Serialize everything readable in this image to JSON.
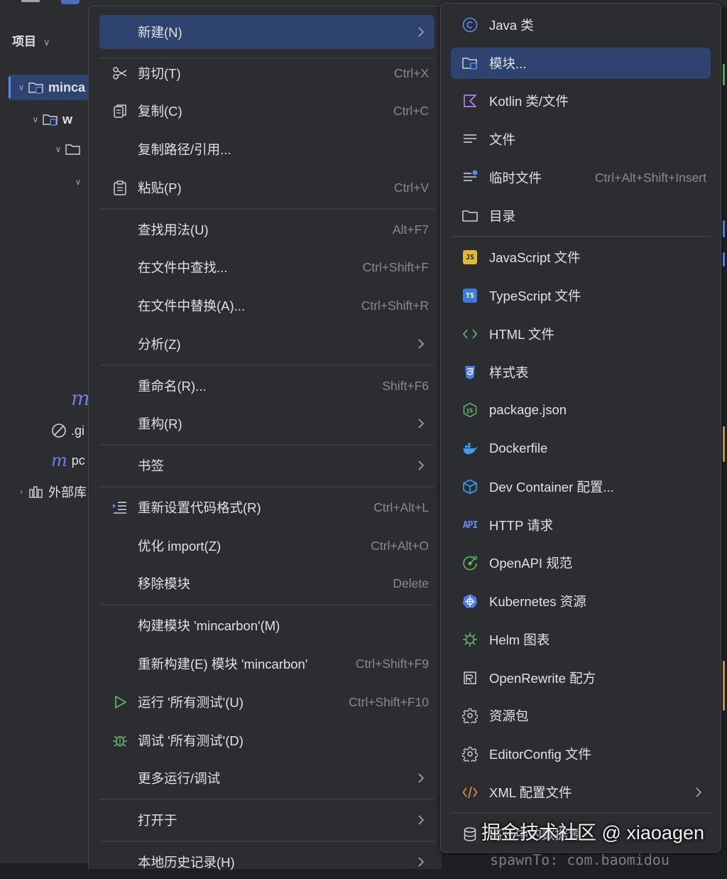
{
  "project_panel": {
    "title": "项目",
    "tree": {
      "root_label": "minca",
      "child_label": "w",
      "gitignore_label": ".gi",
      "pom_label": "pc",
      "external_label": "外部库",
      "maven_letter": "m"
    }
  },
  "context_menu": {
    "items": [
      {
        "label": "新建(N)",
        "shortcut": "",
        "icon": "none",
        "submenu": true
      },
      {
        "label": "剪切(T)",
        "shortcut": "Ctrl+X",
        "icon": "scissors-icon",
        "submenu": false
      },
      {
        "label": "复制(C)",
        "shortcut": "Ctrl+C",
        "icon": "copy-icon",
        "submenu": false
      },
      {
        "label": "复制路径/引用...",
        "shortcut": "",
        "icon": "none",
        "submenu": false
      },
      {
        "label": "粘贴(P)",
        "shortcut": "Ctrl+V",
        "icon": "paste-icon",
        "submenu": false
      },
      {
        "label": "查找用法(U)",
        "shortcut": "Alt+F7",
        "icon": "none",
        "submenu": false
      },
      {
        "label": "在文件中查找...",
        "shortcut": "Ctrl+Shift+F",
        "icon": "none",
        "submenu": false
      },
      {
        "label": "在文件中替换(A)...",
        "shortcut": "Ctrl+Shift+R",
        "icon": "none",
        "submenu": false
      },
      {
        "label": "分析(Z)",
        "shortcut": "",
        "icon": "none",
        "submenu": true
      },
      {
        "label": "重命名(R)...",
        "shortcut": "Shift+F6",
        "icon": "none",
        "submenu": false
      },
      {
        "label": "重构(R)",
        "shortcut": "",
        "icon": "none",
        "submenu": true
      },
      {
        "label": "书签",
        "shortcut": "",
        "icon": "none",
        "submenu": true
      },
      {
        "label": "重新设置代码格式(R)",
        "shortcut": "Ctrl+Alt+L",
        "icon": "reformat-icon",
        "submenu": false
      },
      {
        "label": "优化 import(Z)",
        "shortcut": "Ctrl+Alt+O",
        "icon": "none",
        "submenu": false
      },
      {
        "label": "移除模块",
        "shortcut": "Delete",
        "icon": "none",
        "submenu": false
      },
      {
        "label": "构建模块 'mincarbon'(M)",
        "shortcut": "",
        "icon": "none",
        "submenu": false
      },
      {
        "label": "重新构建(E) 模块 'mincarbon'",
        "shortcut": "Ctrl+Shift+F9",
        "icon": "none",
        "submenu": false
      },
      {
        "label": "运行 '所有测试'(U)",
        "shortcut": "Ctrl+Shift+F10",
        "icon": "run-icon",
        "submenu": false
      },
      {
        "label": "调试 '所有测试'(D)",
        "shortcut": "",
        "icon": "debug-bug-icon",
        "submenu": false
      },
      {
        "label": "更多运行/调试",
        "shortcut": "",
        "icon": "none",
        "submenu": true
      },
      {
        "label": "打开于",
        "shortcut": "",
        "icon": "none",
        "submenu": true
      },
      {
        "label": "本地历史记录(H)",
        "shortcut": "",
        "icon": "none",
        "submenu": true
      }
    ]
  },
  "new_submenu": {
    "items": [
      {
        "label": "Java 类",
        "shortcut": "",
        "icon": "java-class-icon"
      },
      {
        "label": "模块...",
        "shortcut": "",
        "icon": "module-icon"
      },
      {
        "label": "Kotlin 类/文件",
        "shortcut": "",
        "icon": "kotlin-icon"
      },
      {
        "label": "文件",
        "shortcut": "",
        "icon": "file-icon"
      },
      {
        "label": "临时文件",
        "shortcut": "Ctrl+Alt+Shift+Insert",
        "icon": "scratch-file-icon"
      },
      {
        "label": "目录",
        "shortcut": "",
        "icon": "folder-icon"
      },
      {
        "label": "JavaScript 文件",
        "shortcut": "",
        "icon": "javascript-icon"
      },
      {
        "label": "TypeScript 文件",
        "shortcut": "",
        "icon": "typescript-icon"
      },
      {
        "label": "HTML 文件",
        "shortcut": "",
        "icon": "html-icon"
      },
      {
        "label": "样式表",
        "shortcut": "",
        "icon": "css-icon"
      },
      {
        "label": "package.json",
        "shortcut": "",
        "icon": "nodejs-icon"
      },
      {
        "label": "Dockerfile",
        "shortcut": "",
        "icon": "docker-icon"
      },
      {
        "label": "Dev Container 配置...",
        "shortcut": "",
        "icon": "dev-container-icon"
      },
      {
        "label": "HTTP 请求",
        "shortcut": "",
        "icon": "api-icon"
      },
      {
        "label": "OpenAPI 规范",
        "shortcut": "",
        "icon": "openapi-icon"
      },
      {
        "label": "Kubernetes 资源",
        "shortcut": "",
        "icon": "kubernetes-icon"
      },
      {
        "label": "Helm 图表",
        "shortcut": "",
        "icon": "helm-icon"
      },
      {
        "label": "OpenRewrite 配方",
        "shortcut": "",
        "icon": "openrewrite-icon"
      },
      {
        "label": "资源包",
        "shortcut": "",
        "icon": "resource-bundle-icon"
      },
      {
        "label": "EditorConfig 文件",
        "shortcut": "",
        "icon": "editorconfig-icon"
      },
      {
        "label": "XML 配置文件",
        "shortcut": "",
        "icon": "xml-icon"
      },
      {
        "label": "路径中的数据源",
        "shortcut": "",
        "icon": "datasource-icon"
      }
    ],
    "icon_badges": {
      "js": "JS",
      "ts": "TS",
      "api": "API"
    }
  },
  "watermark": "掘金技术社区 @ xiaoagen",
  "background_text": "spawnTo: com.baomidou",
  "colors": {
    "menu_bg": "#2b2d30",
    "selection": "#2e436e",
    "accent": "#548af7",
    "text": "#dfe1e5",
    "shortcut": "#868a91"
  }
}
